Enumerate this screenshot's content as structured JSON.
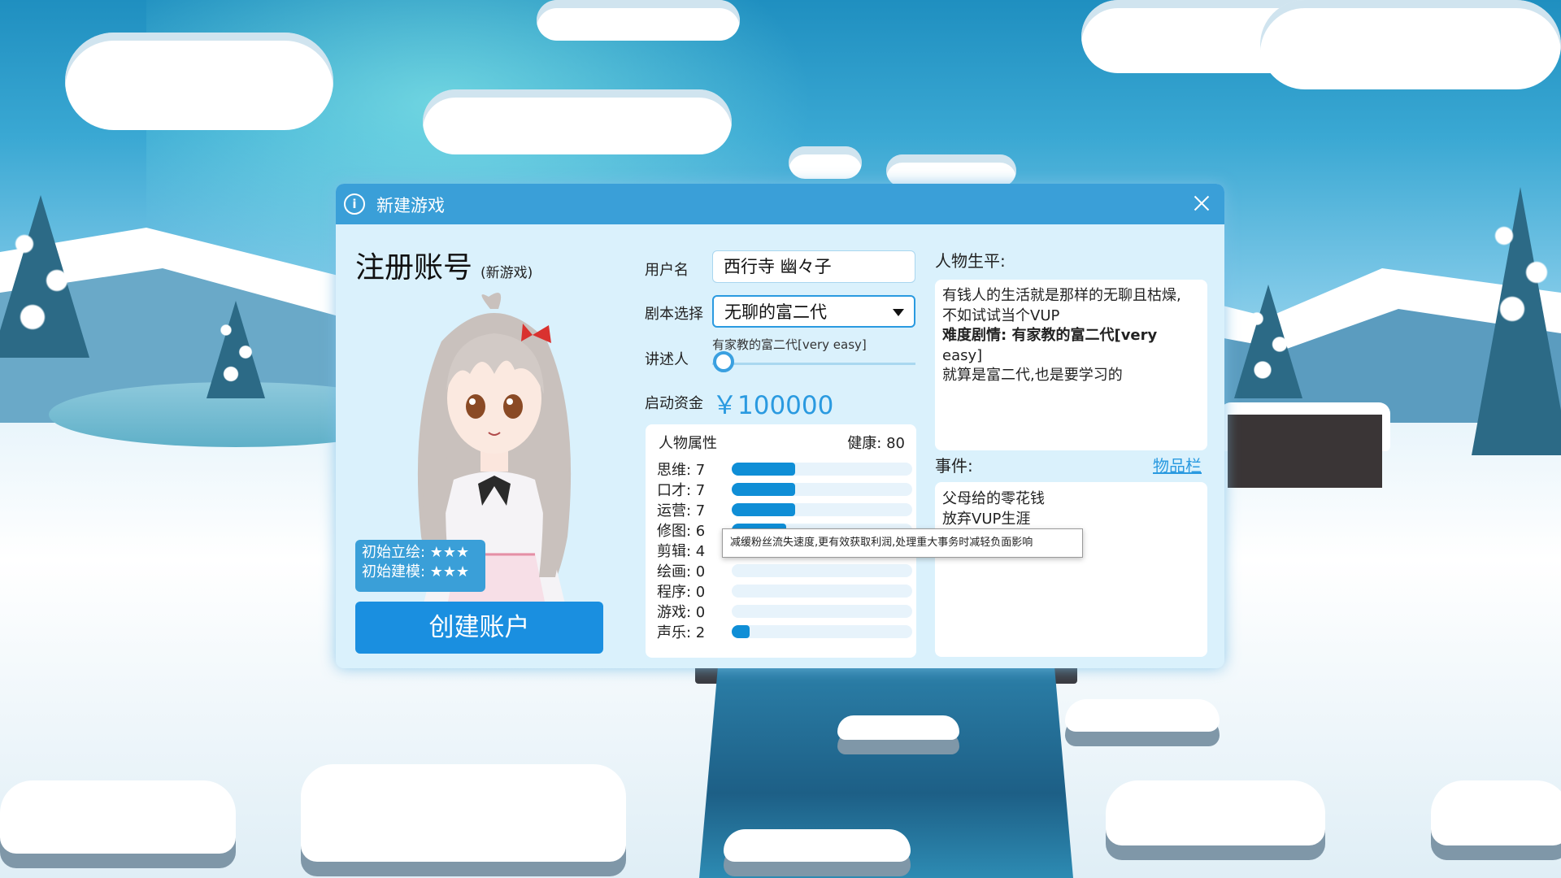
{
  "dialog": {
    "title": "新建游戏"
  },
  "register": {
    "title": "注册账号",
    "subtitle": "(新游戏)",
    "badge_line1": "初始立绘: ★★★",
    "badge_line2": "初始建模: ★★★",
    "create_button": "创建账户"
  },
  "form": {
    "username_label": "用户名",
    "username_value": "西行寺 幽々子",
    "script_label": "剧本选择",
    "script_value": "无聊的富二代",
    "narrator_label": "讲述人",
    "narrator_value": "有家教的富二代[very easy]",
    "funds_label": "启动资金",
    "funds_value": "￥100000"
  },
  "attributes": {
    "title": "人物属性",
    "health": "健康: 80",
    "max": 20,
    "items": [
      {
        "label": "思维: 7",
        "value": 7
      },
      {
        "label": "口才: 7",
        "value": 7
      },
      {
        "label": "运营: 7",
        "value": 7
      },
      {
        "label": "修图: 6",
        "value": 6
      },
      {
        "label": "剪辑: 4",
        "value": 4
      },
      {
        "label": "绘画: 0",
        "value": 0
      },
      {
        "label": "程序: 0",
        "value": 0
      },
      {
        "label": "游戏: 0",
        "value": 0
      },
      {
        "label": "声乐: 2",
        "value": 2
      }
    ]
  },
  "tooltip": "减缓粉丝流失速度,更有效获取利润,处理重大事务时减轻负面影响",
  "bio": {
    "label": "人物生平:",
    "line1": "有钱人的生活就是那样的无聊且枯燥,",
    "line2": "不如试试当个VUP",
    "line3": "难度剧情: 有家教的富二代[very",
    "line4": "easy]",
    "line5": "就算是富二代,也是要学习的"
  },
  "events": {
    "label": "事件:",
    "items_link": "物品栏",
    "list": [
      "父母给的零花钱",
      "放弃VUP生涯"
    ]
  },
  "colors": {
    "accent": "#3a9fd8",
    "button": "#1a8fe0",
    "bar_fill": "#0f8ed6",
    "panel_bg": "#daf1fc"
  }
}
